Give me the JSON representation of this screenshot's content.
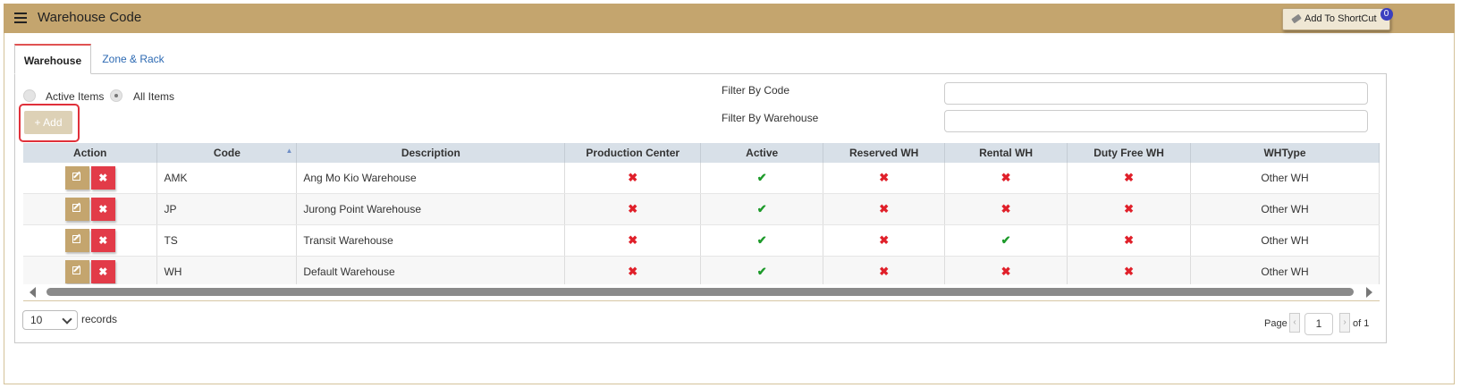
{
  "header": {
    "title": "Warehouse Code",
    "shortcut_label": "Add To ShortCut",
    "shortcut_count": "0"
  },
  "tabs": [
    {
      "label": "Warehouse"
    },
    {
      "label": "Zone & Rack"
    }
  ],
  "filters": {
    "active_items_label": "Active Items",
    "all_items_label": "All Items",
    "add_label": "+ Add",
    "filter_code_label": "Filter By Code",
    "filter_warehouse_label": "Filter By Warehouse",
    "filter_code_value": "",
    "filter_warehouse_value": ""
  },
  "table": {
    "columns": [
      "Action",
      "Code",
      "Description",
      "Production Center",
      "Active",
      "Reserved WH",
      "Rental WH",
      "Duty Free WH",
      "WHType"
    ],
    "rows": [
      {
        "code": "AMK",
        "description": "Ang Mo Kio Warehouse",
        "production_center": false,
        "active": true,
        "reserved_wh": false,
        "rental_wh": false,
        "duty_free_wh": false,
        "whtype": "Other WH"
      },
      {
        "code": "JP",
        "description": "Jurong Point Warehouse",
        "production_center": false,
        "active": true,
        "reserved_wh": false,
        "rental_wh": false,
        "duty_free_wh": false,
        "whtype": "Other WH"
      },
      {
        "code": "TS",
        "description": "Transit Warehouse",
        "production_center": false,
        "active": true,
        "reserved_wh": false,
        "rental_wh": true,
        "duty_free_wh": false,
        "whtype": "Other WH"
      },
      {
        "code": "WH",
        "description": "Default Warehouse",
        "production_center": false,
        "active": true,
        "reserved_wh": false,
        "rental_wh": false,
        "duty_free_wh": false,
        "whtype": "Other WH"
      }
    ]
  },
  "pagination": {
    "page_size": "10",
    "records_label": "records",
    "page_label": "Page",
    "current_page": "1",
    "of_label": "of 1"
  },
  "colors": {
    "header_bg": "#c4a56e",
    "edit_btn": "#c4a56e",
    "delete_btn": "#e23b48",
    "check": "#1d9a2a",
    "cross": "#e0202a"
  }
}
